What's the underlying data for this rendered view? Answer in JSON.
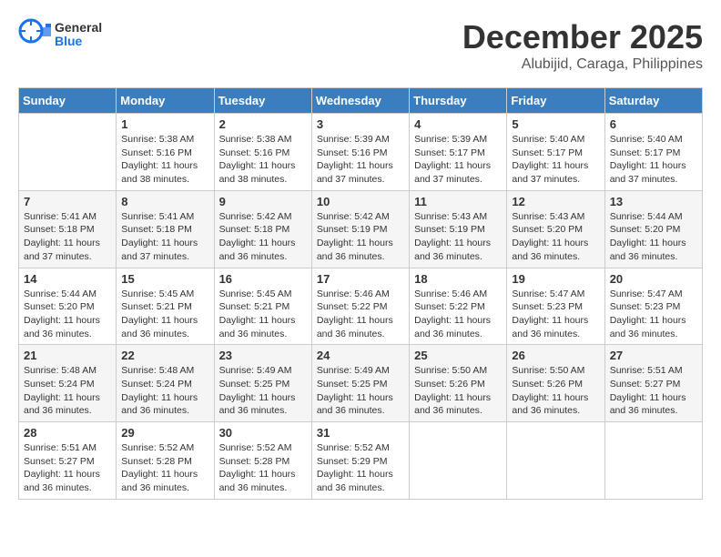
{
  "header": {
    "logo_text_general": "General",
    "logo_text_blue": "Blue",
    "month": "December 2025",
    "location": "Alubijid, Caraga, Philippines"
  },
  "days_of_week": [
    "Sunday",
    "Monday",
    "Tuesday",
    "Wednesday",
    "Thursday",
    "Friday",
    "Saturday"
  ],
  "weeks": [
    [
      {
        "day": "",
        "sunrise": "",
        "sunset": "",
        "daylight": ""
      },
      {
        "day": "1",
        "sunrise": "Sunrise: 5:38 AM",
        "sunset": "Sunset: 5:16 PM",
        "daylight": "Daylight: 11 hours and 38 minutes."
      },
      {
        "day": "2",
        "sunrise": "Sunrise: 5:38 AM",
        "sunset": "Sunset: 5:16 PM",
        "daylight": "Daylight: 11 hours and 38 minutes."
      },
      {
        "day": "3",
        "sunrise": "Sunrise: 5:39 AM",
        "sunset": "Sunset: 5:16 PM",
        "daylight": "Daylight: 11 hours and 37 minutes."
      },
      {
        "day": "4",
        "sunrise": "Sunrise: 5:39 AM",
        "sunset": "Sunset: 5:17 PM",
        "daylight": "Daylight: 11 hours and 37 minutes."
      },
      {
        "day": "5",
        "sunrise": "Sunrise: 5:40 AM",
        "sunset": "Sunset: 5:17 PM",
        "daylight": "Daylight: 11 hours and 37 minutes."
      },
      {
        "day": "6",
        "sunrise": "Sunrise: 5:40 AM",
        "sunset": "Sunset: 5:17 PM",
        "daylight": "Daylight: 11 hours and 37 minutes."
      }
    ],
    [
      {
        "day": "7",
        "sunrise": "Sunrise: 5:41 AM",
        "sunset": "Sunset: 5:18 PM",
        "daylight": "Daylight: 11 hours and 37 minutes."
      },
      {
        "day": "8",
        "sunrise": "Sunrise: 5:41 AM",
        "sunset": "Sunset: 5:18 PM",
        "daylight": "Daylight: 11 hours and 37 minutes."
      },
      {
        "day": "9",
        "sunrise": "Sunrise: 5:42 AM",
        "sunset": "Sunset: 5:18 PM",
        "daylight": "Daylight: 11 hours and 36 minutes."
      },
      {
        "day": "10",
        "sunrise": "Sunrise: 5:42 AM",
        "sunset": "Sunset: 5:19 PM",
        "daylight": "Daylight: 11 hours and 36 minutes."
      },
      {
        "day": "11",
        "sunrise": "Sunrise: 5:43 AM",
        "sunset": "Sunset: 5:19 PM",
        "daylight": "Daylight: 11 hours and 36 minutes."
      },
      {
        "day": "12",
        "sunrise": "Sunrise: 5:43 AM",
        "sunset": "Sunset: 5:20 PM",
        "daylight": "Daylight: 11 hours and 36 minutes."
      },
      {
        "day": "13",
        "sunrise": "Sunrise: 5:44 AM",
        "sunset": "Sunset: 5:20 PM",
        "daylight": "Daylight: 11 hours and 36 minutes."
      }
    ],
    [
      {
        "day": "14",
        "sunrise": "Sunrise: 5:44 AM",
        "sunset": "Sunset: 5:20 PM",
        "daylight": "Daylight: 11 hours and 36 minutes."
      },
      {
        "day": "15",
        "sunrise": "Sunrise: 5:45 AM",
        "sunset": "Sunset: 5:21 PM",
        "daylight": "Daylight: 11 hours and 36 minutes."
      },
      {
        "day": "16",
        "sunrise": "Sunrise: 5:45 AM",
        "sunset": "Sunset: 5:21 PM",
        "daylight": "Daylight: 11 hours and 36 minutes."
      },
      {
        "day": "17",
        "sunrise": "Sunrise: 5:46 AM",
        "sunset": "Sunset: 5:22 PM",
        "daylight": "Daylight: 11 hours and 36 minutes."
      },
      {
        "day": "18",
        "sunrise": "Sunrise: 5:46 AM",
        "sunset": "Sunset: 5:22 PM",
        "daylight": "Daylight: 11 hours and 36 minutes."
      },
      {
        "day": "19",
        "sunrise": "Sunrise: 5:47 AM",
        "sunset": "Sunset: 5:23 PM",
        "daylight": "Daylight: 11 hours and 36 minutes."
      },
      {
        "day": "20",
        "sunrise": "Sunrise: 5:47 AM",
        "sunset": "Sunset: 5:23 PM",
        "daylight": "Daylight: 11 hours and 36 minutes."
      }
    ],
    [
      {
        "day": "21",
        "sunrise": "Sunrise: 5:48 AM",
        "sunset": "Sunset: 5:24 PM",
        "daylight": "Daylight: 11 hours and 36 minutes."
      },
      {
        "day": "22",
        "sunrise": "Sunrise: 5:48 AM",
        "sunset": "Sunset: 5:24 PM",
        "daylight": "Daylight: 11 hours and 36 minutes."
      },
      {
        "day": "23",
        "sunrise": "Sunrise: 5:49 AM",
        "sunset": "Sunset: 5:25 PM",
        "daylight": "Daylight: 11 hours and 36 minutes."
      },
      {
        "day": "24",
        "sunrise": "Sunrise: 5:49 AM",
        "sunset": "Sunset: 5:25 PM",
        "daylight": "Daylight: 11 hours and 36 minutes."
      },
      {
        "day": "25",
        "sunrise": "Sunrise: 5:50 AM",
        "sunset": "Sunset: 5:26 PM",
        "daylight": "Daylight: 11 hours and 36 minutes."
      },
      {
        "day": "26",
        "sunrise": "Sunrise: 5:50 AM",
        "sunset": "Sunset: 5:26 PM",
        "daylight": "Daylight: 11 hours and 36 minutes."
      },
      {
        "day": "27",
        "sunrise": "Sunrise: 5:51 AM",
        "sunset": "Sunset: 5:27 PM",
        "daylight": "Daylight: 11 hours and 36 minutes."
      }
    ],
    [
      {
        "day": "28",
        "sunrise": "Sunrise: 5:51 AM",
        "sunset": "Sunset: 5:27 PM",
        "daylight": "Daylight: 11 hours and 36 minutes."
      },
      {
        "day": "29",
        "sunrise": "Sunrise: 5:52 AM",
        "sunset": "Sunset: 5:28 PM",
        "daylight": "Daylight: 11 hours and 36 minutes."
      },
      {
        "day": "30",
        "sunrise": "Sunrise: 5:52 AM",
        "sunset": "Sunset: 5:28 PM",
        "daylight": "Daylight: 11 hours and 36 minutes."
      },
      {
        "day": "31",
        "sunrise": "Sunrise: 5:52 AM",
        "sunset": "Sunset: 5:29 PM",
        "daylight": "Daylight: 11 hours and 36 minutes."
      },
      {
        "day": "",
        "sunrise": "",
        "sunset": "",
        "daylight": ""
      },
      {
        "day": "",
        "sunrise": "",
        "sunset": "",
        "daylight": ""
      },
      {
        "day": "",
        "sunrise": "",
        "sunset": "",
        "daylight": ""
      }
    ]
  ]
}
